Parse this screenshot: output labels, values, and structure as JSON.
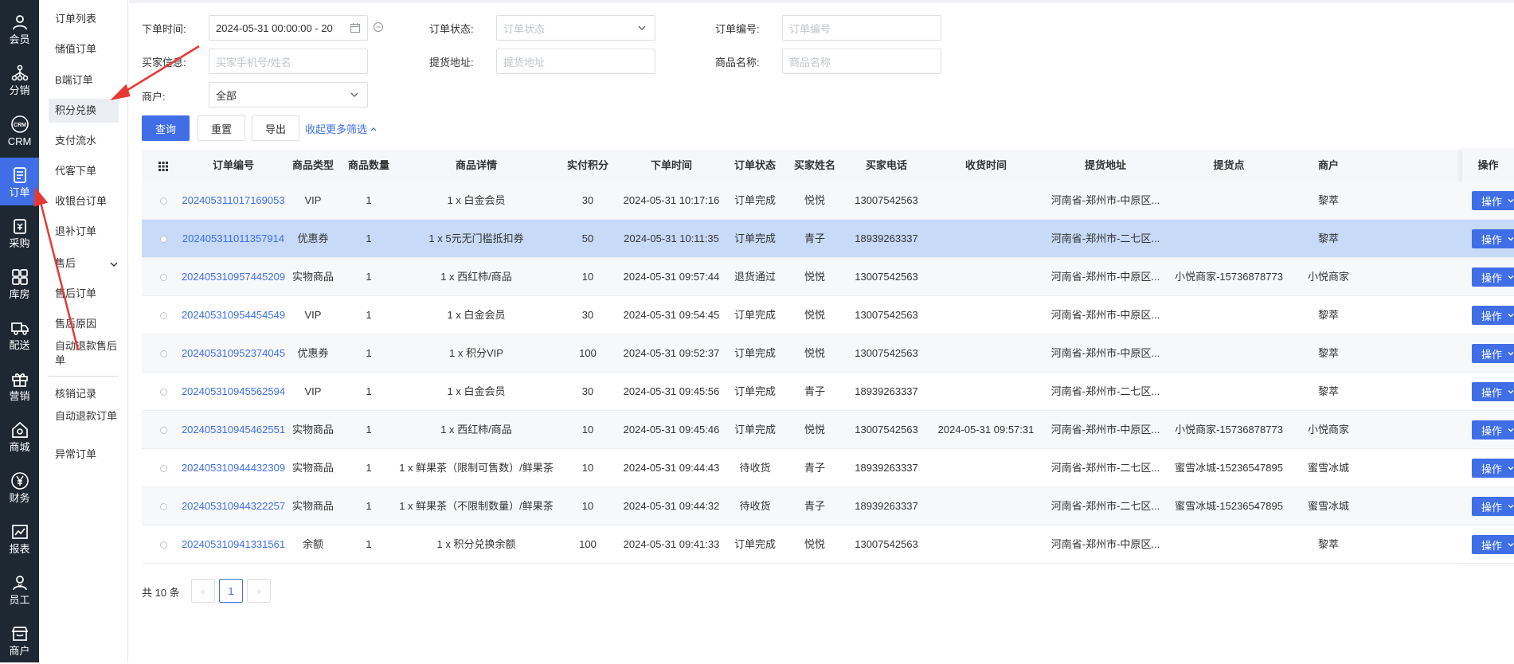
{
  "nav": [
    {
      "label": "会员",
      "icon": "user-icon"
    },
    {
      "label": "分销",
      "icon": "network-icon"
    },
    {
      "label": "CRM",
      "icon": "crm-icon"
    },
    {
      "label": "订单",
      "icon": "order-icon"
    },
    {
      "label": "采购",
      "icon": "purchase-icon"
    },
    {
      "label": "库房",
      "icon": "warehouse-icon"
    },
    {
      "label": "配送",
      "icon": "truck-icon"
    },
    {
      "label": "营销",
      "icon": "gift-icon"
    },
    {
      "label": "商城",
      "icon": "shop-icon"
    },
    {
      "label": "财务",
      "icon": "yen-icon"
    },
    {
      "label": "报表",
      "icon": "chart-icon"
    },
    {
      "label": "员工",
      "icon": "staff-icon"
    },
    {
      "label": "商户",
      "icon": "merchant-icon"
    }
  ],
  "submenu": {
    "items": [
      "订单列表",
      "储值订单",
      "B端订单",
      "积分兑换",
      "支付流水",
      "代客下单",
      "收银台订单",
      "退补订单"
    ],
    "group_label": "售后",
    "group_items": [
      "售后订单",
      "售后原因",
      "自动退款售后单"
    ],
    "items2": [
      "核销记录",
      "自动退款订单",
      "异常订单"
    ]
  },
  "filters": {
    "order_time_label": "下单时间:",
    "order_time_value": "2024-05-31 00:00:00 - 20",
    "order_status_label": "订单状态:",
    "order_status_placeholder": "订单状态",
    "order_no_label": "订单编号:",
    "order_no_placeholder": "订单编号",
    "buyer_label": "买家信息:",
    "buyer_placeholder": "买家手机号/姓名",
    "pickup_label": "提货地址:",
    "pickup_placeholder": "提货地址",
    "product_label": "商品名称:",
    "product_placeholder": "商品名称",
    "merchant_label": "商户:",
    "merchant_value": "全部"
  },
  "actions": {
    "query": "查询",
    "reset": "重置",
    "export": "导出",
    "collapse": "收起更多筛选"
  },
  "table": {
    "headers": [
      "订单编号",
      "商品类型",
      "商品数量",
      "商品详情",
      "实付积分",
      "下单时间",
      "订单状态",
      "买家姓名",
      "买家电话",
      "收货时间",
      "提货地址",
      "提货点",
      "商户",
      "操作"
    ],
    "op_label": "操作",
    "rows": [
      {
        "id": "202405311017169053",
        "type": "VIP",
        "qty": "1",
        "detail": "1 x 白金会员",
        "points": "30",
        "time": "2024-05-31 10:17:16",
        "status": "订单完成",
        "buyer": "悦悦",
        "phone": "13007542563",
        "recv": "",
        "addr": "河南省-郑州市-中原区...",
        "pickup": "",
        "merchant": "黎萃"
      },
      {
        "id": "202405311011357914",
        "type": "优惠券",
        "qty": "1",
        "detail": "1 x 5元无门槛抵扣券",
        "points": "50",
        "time": "2024-05-31 10:11:35",
        "status": "订单完成",
        "buyer": "青子",
        "phone": "18939263337",
        "recv": "",
        "addr": "河南省-郑州市-二七区...",
        "pickup": "",
        "merchant": "黎萃"
      },
      {
        "id": "202405310957445209",
        "type": "实物商品",
        "qty": "1",
        "detail": "1 x 西红柿/商品",
        "points": "10",
        "time": "2024-05-31 09:57:44",
        "status": "退货通过",
        "buyer": "悦悦",
        "phone": "13007542563",
        "recv": "",
        "addr": "河南省-郑州市-中原区...",
        "pickup": "小悦商家-15736878773",
        "merchant": "小悦商家"
      },
      {
        "id": "202405310954454549",
        "type": "VIP",
        "qty": "1",
        "detail": "1 x 白金会员",
        "points": "30",
        "time": "2024-05-31 09:54:45",
        "status": "订单完成",
        "buyer": "悦悦",
        "phone": "13007542563",
        "recv": "",
        "addr": "河南省-郑州市-中原区...",
        "pickup": "",
        "merchant": "黎萃"
      },
      {
        "id": "202405310952374045",
        "type": "优惠券",
        "qty": "1",
        "detail": "1 x 积分VIP",
        "points": "100",
        "time": "2024-05-31 09:52:37",
        "status": "订单完成",
        "buyer": "悦悦",
        "phone": "13007542563",
        "recv": "",
        "addr": "河南省-郑州市-中原区...",
        "pickup": "",
        "merchant": "黎萃"
      },
      {
        "id": "202405310945562594",
        "type": "VIP",
        "qty": "1",
        "detail": "1 x 白金会员",
        "points": "30",
        "time": "2024-05-31 09:45:56",
        "status": "订单完成",
        "buyer": "青子",
        "phone": "18939263337",
        "recv": "",
        "addr": "河南省-郑州市-二七区...",
        "pickup": "",
        "merchant": "黎萃"
      },
      {
        "id": "202405310945462551",
        "type": "实物商品",
        "qty": "1",
        "detail": "1 x 西红柿/商品",
        "points": "10",
        "time": "2024-05-31 09:45:46",
        "status": "订单完成",
        "buyer": "悦悦",
        "phone": "13007542563",
        "recv": "2024-05-31 09:57:31",
        "addr": "河南省-郑州市-中原区...",
        "pickup": "小悦商家-15736878773",
        "merchant": "小悦商家"
      },
      {
        "id": "202405310944432309",
        "type": "实物商品",
        "qty": "1",
        "detail": "1 x 鲜果茶（限制可售数）/鲜果茶",
        "points": "10",
        "time": "2024-05-31 09:44:43",
        "status": "待收货",
        "buyer": "青子",
        "phone": "18939263337",
        "recv": "",
        "addr": "河南省-郑州市-二七区...",
        "pickup": "蜜雪冰城-15236547895",
        "merchant": "蜜雪冰城"
      },
      {
        "id": "202405310944322257",
        "type": "实物商品",
        "qty": "1",
        "detail": "1 x 鲜果茶（不限制数量）/鲜果茶",
        "points": "10",
        "time": "2024-05-31 09:44:32",
        "status": "待收货",
        "buyer": "青子",
        "phone": "18939263337",
        "recv": "",
        "addr": "河南省-郑州市-二七区...",
        "pickup": "蜜雪冰城-15236547895",
        "merchant": "蜜雪冰城"
      },
      {
        "id": "202405310941331561",
        "type": "余额",
        "qty": "1",
        "detail": "1 x 积分兑换余额",
        "points": "100",
        "time": "2024-05-31 09:41:33",
        "status": "订单完成",
        "buyer": "悦悦",
        "phone": "13007542563",
        "recv": "",
        "addr": "河南省-郑州市-中原区...",
        "pickup": "",
        "merchant": "黎萃"
      }
    ]
  },
  "pagination": {
    "total": "共 10 条",
    "prev": "‹",
    "current": "1",
    "next": "›"
  },
  "colors": {
    "nav_bg": "#1d2833",
    "accent": "#3f6ee6",
    "selected_row": "#c7daf7",
    "annotation_arrow": "#e53935"
  }
}
